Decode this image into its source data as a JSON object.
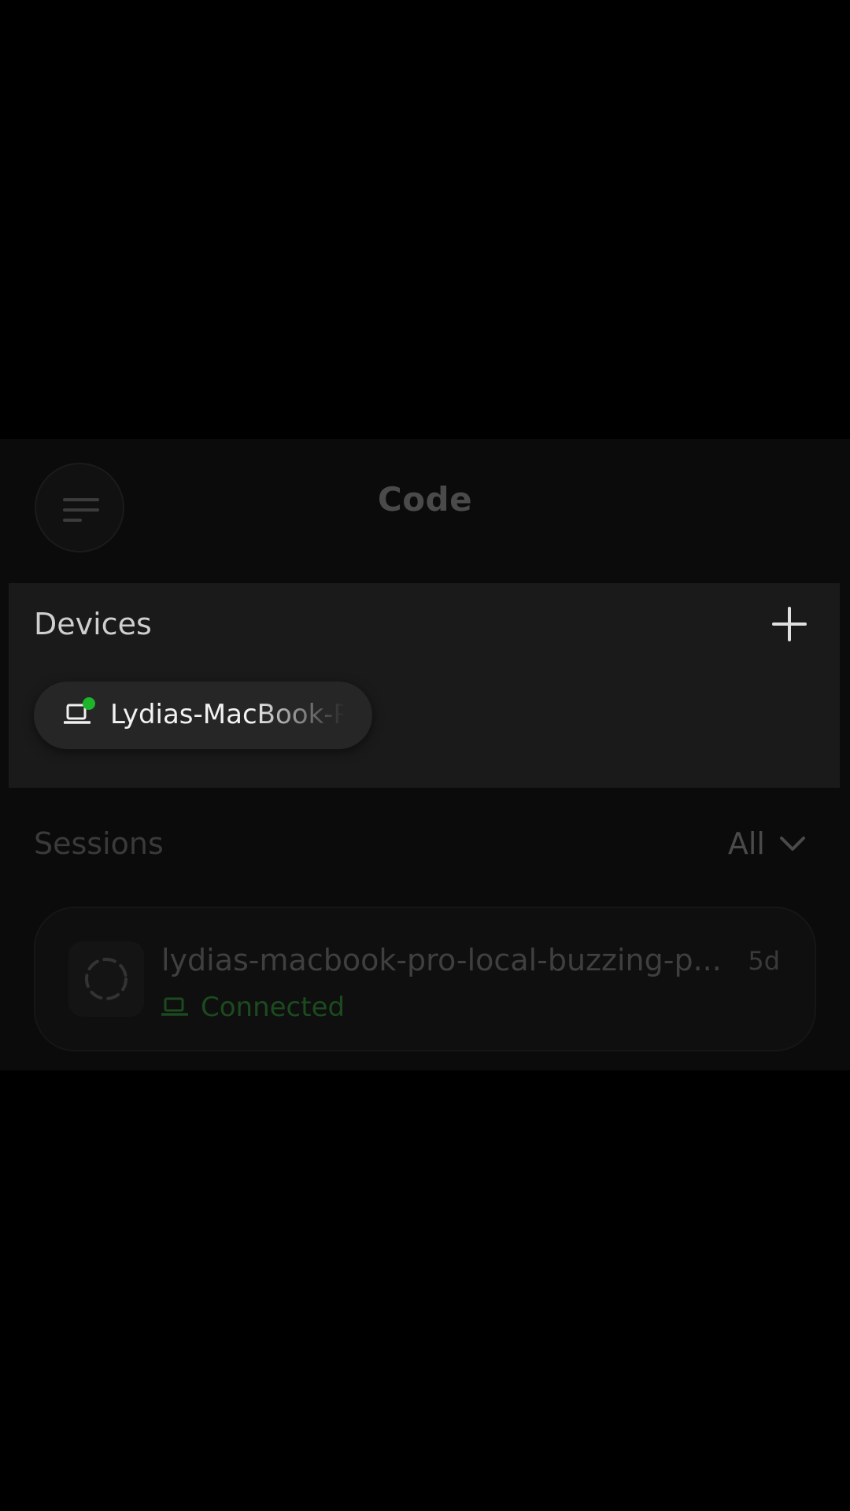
{
  "header": {
    "title": "Code",
    "menu_icon": "menu-icon"
  },
  "devices": {
    "title": "Devices",
    "add_icon": "plus-icon",
    "items": [
      {
        "name": "Lydias-MacBook-Pro",
        "icon": "laptop-icon",
        "online": true,
        "status_color": "#1db529"
      }
    ]
  },
  "sessions": {
    "title": "Sessions",
    "filter": {
      "label": "All",
      "icon": "chevron-down-icon"
    },
    "items": [
      {
        "name": "lydias-macbook-pro-local-buzzing-p...",
        "age": "5d",
        "status": "Connected",
        "status_icon": "laptop-icon",
        "status_color": "#1c4a1f"
      }
    ]
  }
}
